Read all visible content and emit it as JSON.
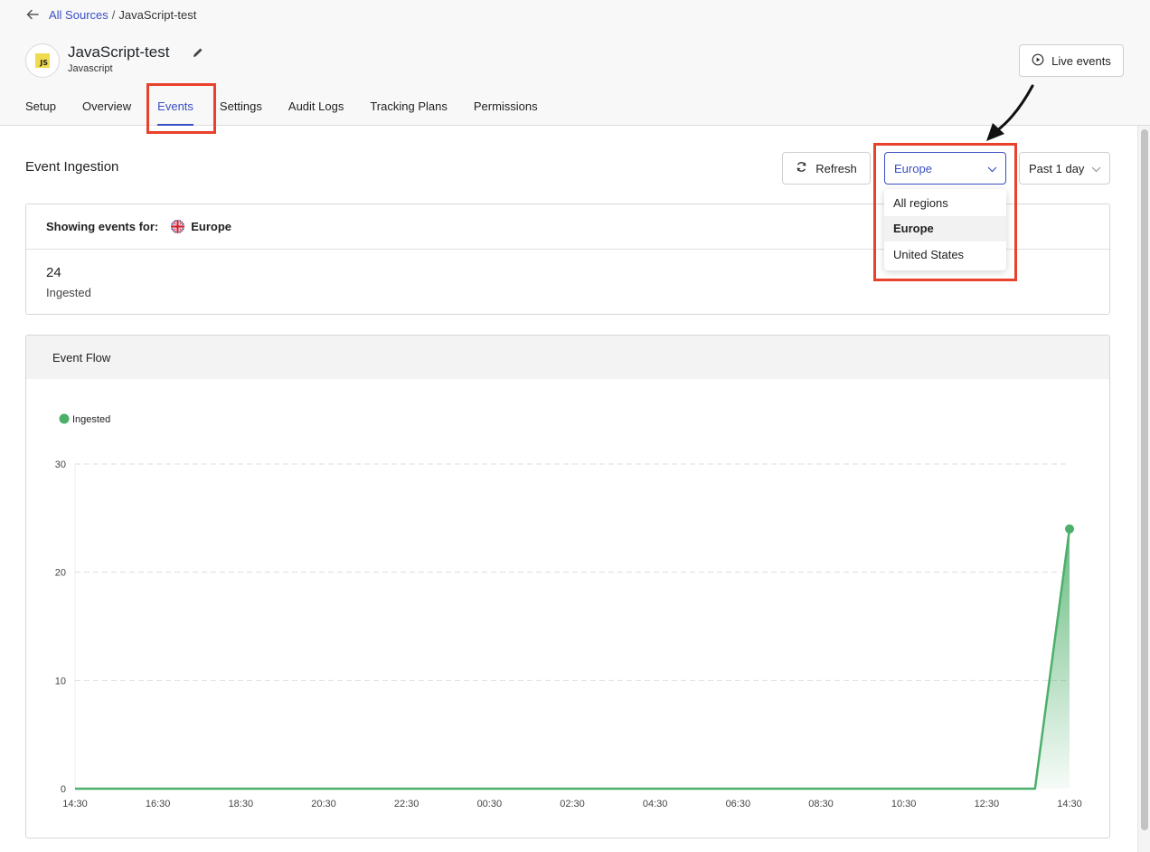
{
  "breadcrumb": {
    "parent": "All Sources",
    "separator": "/",
    "current": "JavaScript-test"
  },
  "source": {
    "name": "JavaScript-test",
    "type": "Javascript",
    "logo_text": "JS"
  },
  "header": {
    "live_events_label": "Live events"
  },
  "tabs": [
    {
      "label": "Setup",
      "active": false
    },
    {
      "label": "Overview",
      "active": false
    },
    {
      "label": "Events",
      "active": true
    },
    {
      "label": "Settings",
      "active": false
    },
    {
      "label": "Audit Logs",
      "active": false
    },
    {
      "label": "Tracking Plans",
      "active": false
    },
    {
      "label": "Permissions",
      "active": false
    }
  ],
  "ingestion": {
    "title": "Event Ingestion",
    "refresh_label": "Refresh",
    "region_selected": "Europe",
    "region_options": [
      "All regions",
      "Europe",
      "United States"
    ],
    "period_selected": "Past 1 day"
  },
  "summary": {
    "showing_label": "Showing events for:",
    "region": "Europe",
    "count": "24",
    "count_label": "Ingested"
  },
  "flow": {
    "title": "Event Flow"
  },
  "colors": {
    "accent": "#3b4fc4",
    "highlight": "#e8412c",
    "series_green": "#4caf6a"
  },
  "chart_data": {
    "type": "area",
    "legend": [
      "Ingested"
    ],
    "x": [
      "14:30",
      "16:30",
      "18:30",
      "20:30",
      "22:30",
      "00:30",
      "02:30",
      "04:30",
      "06:30",
      "08:30",
      "10:30",
      "12:30",
      "14:30"
    ],
    "ylim": [
      0,
      30
    ],
    "yticks": [
      0,
      10,
      20,
      30
    ],
    "series": [
      {
        "name": "Ingested",
        "points": [
          {
            "x": "14:30",
            "y": 0
          },
          {
            "x": "13:40",
            "y": 0
          },
          {
            "x": "14:30",
            "y": 24
          }
        ]
      }
    ],
    "grid": "horizontal-dashed",
    "legend_position": "top-left"
  }
}
